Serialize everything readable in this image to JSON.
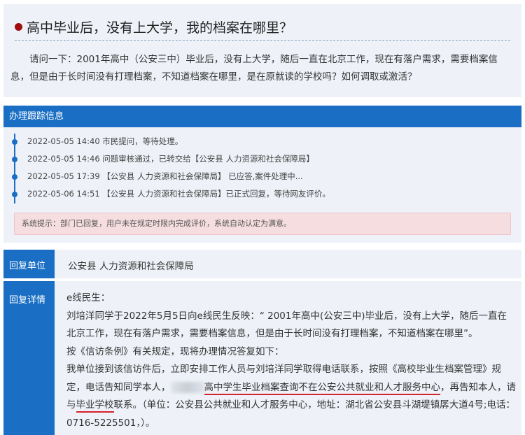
{
  "question": {
    "title": "高中毕业后，没有上大学，我的档案在哪里？",
    "body": "请问一下：2001年高中（公安三中）毕业后，没有上大学，随后一直在北京工作，现在有落户需求，需要档案信息，但是由于长时间没有打理档案，不知道档案在哪里，是在原就读的学校吗？如何调取或激活？"
  },
  "tracking": {
    "header": "办理跟踪信息",
    "items": [
      {
        "text": "2022-05-05 14:40 市民提问，等待处理。"
      },
      {
        "text": "2022-05-05 14:46 问题审核通过，已转交给【公安县 人力资源和社会保障局】"
      },
      {
        "text": "2022-05-05 17:39 【公安县 人力资源和社会保障局】 已应答,案件处理中..."
      },
      {
        "text": "2022-05-06 14:51 【公安县 人力资源和社会保障局】已正式回复，等待网友评价。"
      }
    ],
    "system_notice": "系统提示：部门已回复，用户未在规定时限内完成评价，系统自动认定为满意。"
  },
  "reply_unit": {
    "label": "回复单位",
    "value": "公安县 人力资源和社会保障局"
  },
  "reply_detail": {
    "label": "回复详情",
    "greeting": "e线民生：",
    "para1": "刘培洋同学于2022年5月5日向e线民生反映：“ 2001年高中(公安三中)毕业后，没有上大学，随后一直在北京工作，现在有落户需求，需要档案信息，但是由于长时间没有打理档案，不知道档案在哪里”。",
    "para2": "按《信访条例》有关规定，现将办理情况答复如下：",
    "para3_a": "我单位接到该信访件后，立即安排工作人员与刘培洋同学取得电话联系，按照《高校毕业生档案管理》规定，电话告知同学本人，",
    "para3_b": "高中学生毕业档案查询不在公安公共就业和人才服务中心",
    "para3_c": "，再告知本人，请与",
    "para3_d": "毕业学校",
    "para3_e": "联系。（单位：公安县公共就业和人才服务中心，地址：湖北省公安县斗湖堤镇孱大道4号;电话：0716-5225501，）。"
  },
  "colors": {
    "accent_blue": "#1a6fc4",
    "title_dot": "#a00d0d",
    "underline_red": "#d4222a",
    "notice_bg": "#f6dde0"
  }
}
